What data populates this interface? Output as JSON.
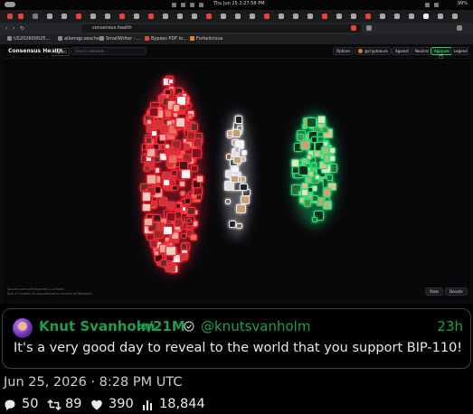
{
  "menubar": {
    "clock": "Thu Jun 25   2:27:58 PM",
    "battery": "99%"
  },
  "browser": {
    "url": "consensus.health",
    "bookmarks": [
      "US202600025...",
      "allomqp.asscha...",
      "SmallWriter - ...",
      "Bypass PDF lo...",
      "Forkelicious"
    ]
  },
  "app": {
    "title": "Consensus Health",
    "badge": "lag/bi0",
    "search_placeholder": "Search datasets...",
    "options_label": "Options",
    "user_label": "@cryptoaura",
    "against_label": "Against",
    "neutral_label": "Neutral",
    "approve_label": "Approve",
    "legend_label": "Legend",
    "footnote_line1": "Sources are self reported & curated.",
    "footnote_line2": "Size of clusters is proportional to number of followers.",
    "stats_button": "Stats",
    "donate_button": "Donate",
    "colors": {
      "against": "#ff2a3a",
      "neutral": "#e8e8ee",
      "approve": "#22e07a"
    }
  },
  "tweet": {
    "name": "Knut Svanholm",
    "followers": "∞/21M",
    "handle": "@knutsvanholm",
    "time": "23h",
    "text": "It's a very good day to reveal to the world that you support BIP-110!",
    "name_color": "#1d9e4f"
  },
  "post_date": "Jun 25, 2026 · 8:28 PM UTC",
  "stats": {
    "replies": "50",
    "reposts": "89",
    "likes": "390",
    "views": "18,844"
  }
}
